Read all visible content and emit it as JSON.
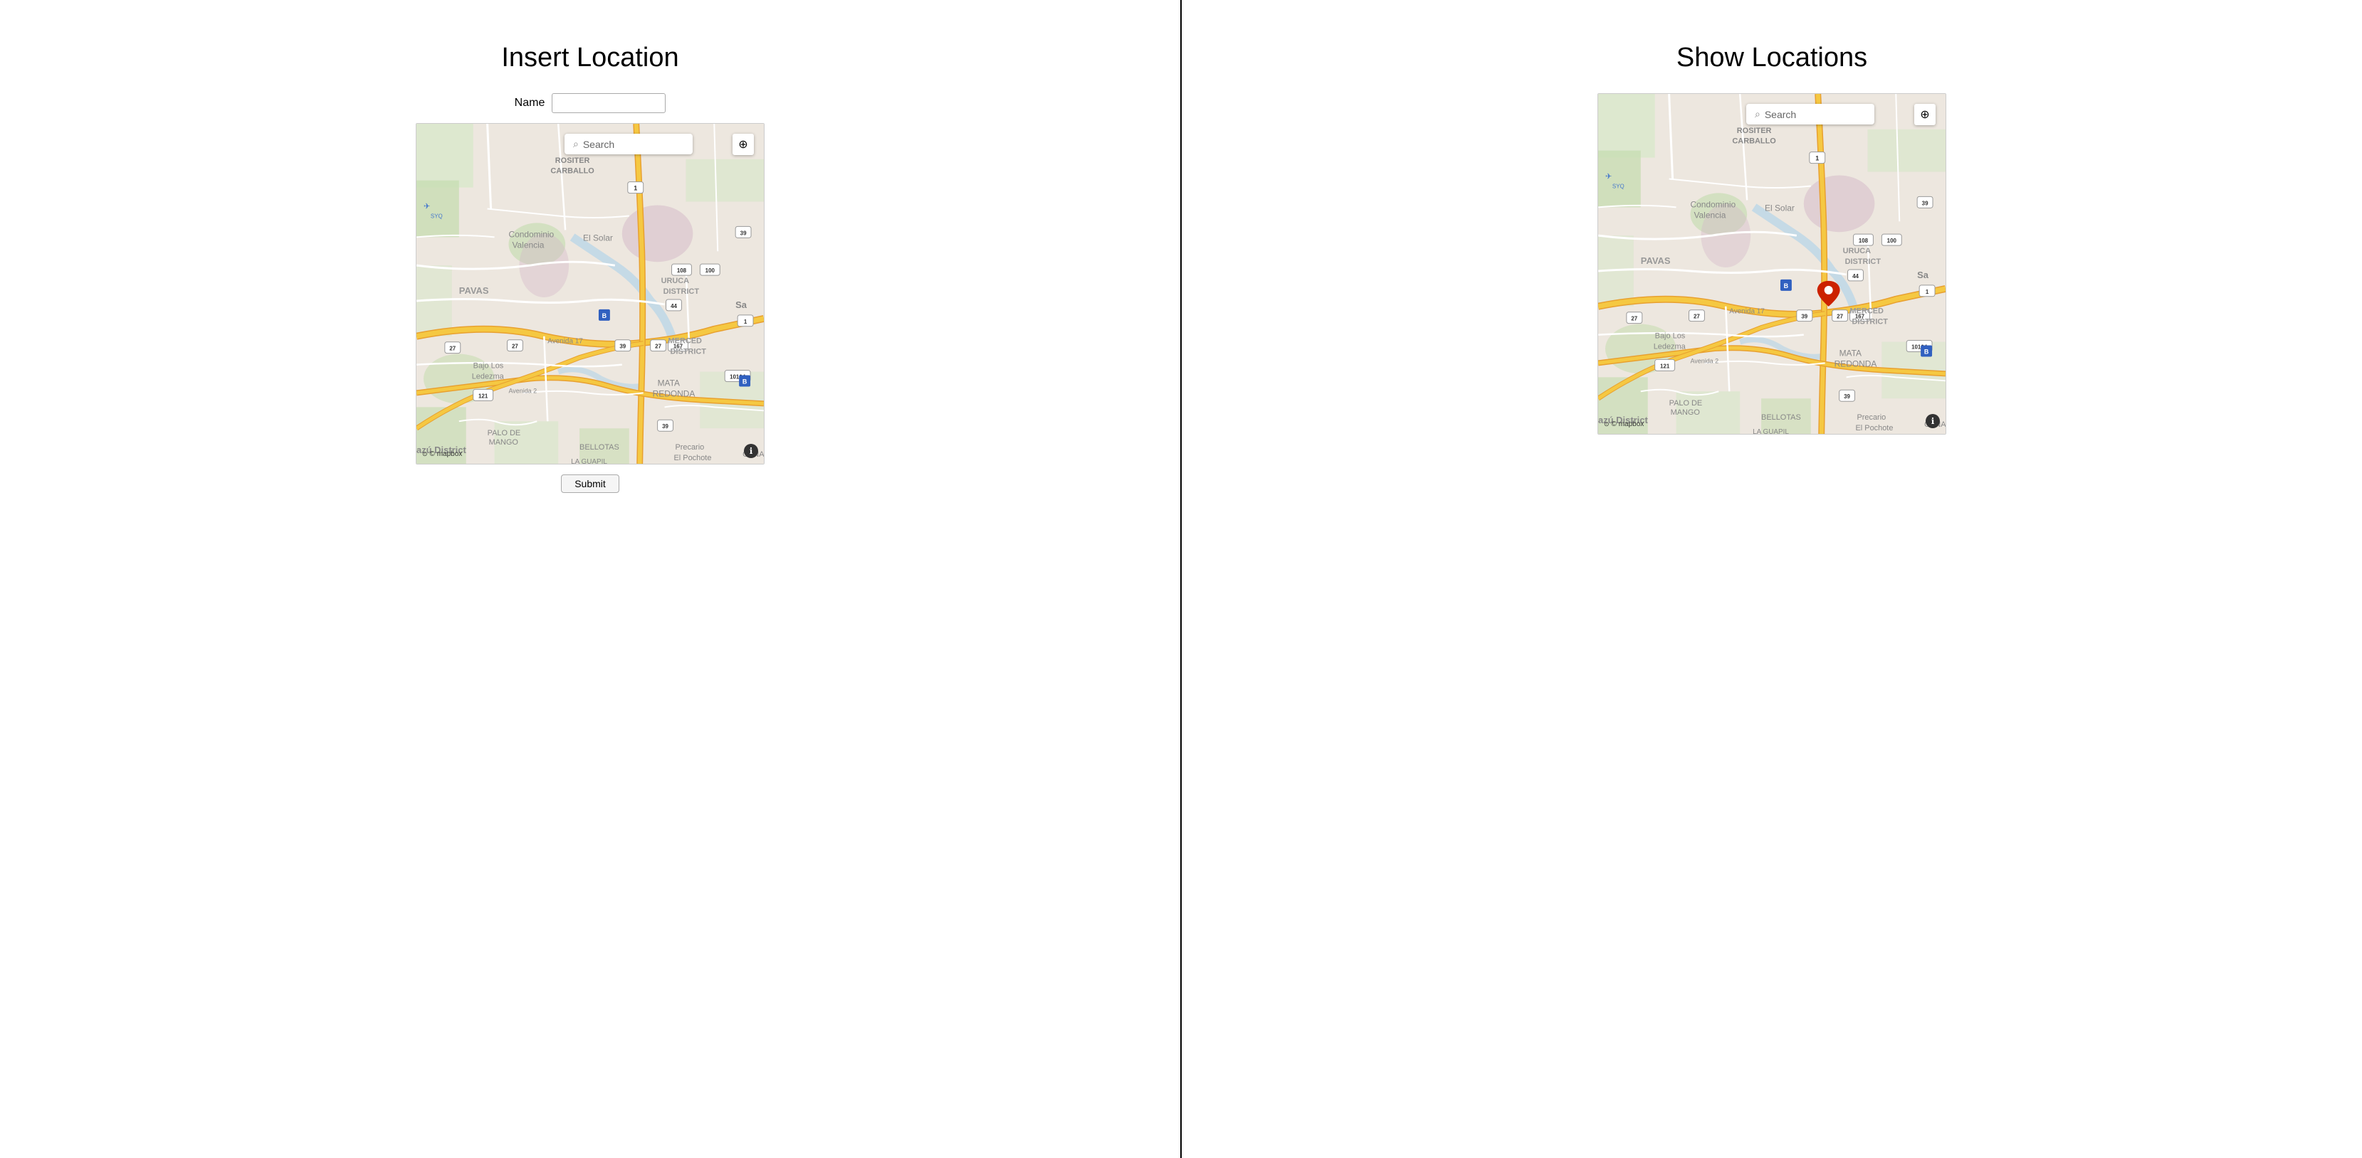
{
  "left_panel": {
    "title": "Insert Location",
    "name_label": "Name",
    "name_placeholder": "",
    "search_placeholder": "Search",
    "submit_label": "Submit"
  },
  "right_panel": {
    "title": "Show Locations",
    "search_placeholder": "Search"
  },
  "map": {
    "attribution": "© mapbox",
    "info_icon": "ℹ",
    "location_icon": "⊕",
    "search_icon": "🔍"
  },
  "colors": {
    "bg": "#ffffff",
    "divider": "#000000",
    "road_major": "#f5c842",
    "road_minor": "#ffffff",
    "park": "#c8ddb3",
    "water": "#b3d4e8",
    "land": "#ede7df",
    "pin": "#cc2200"
  }
}
